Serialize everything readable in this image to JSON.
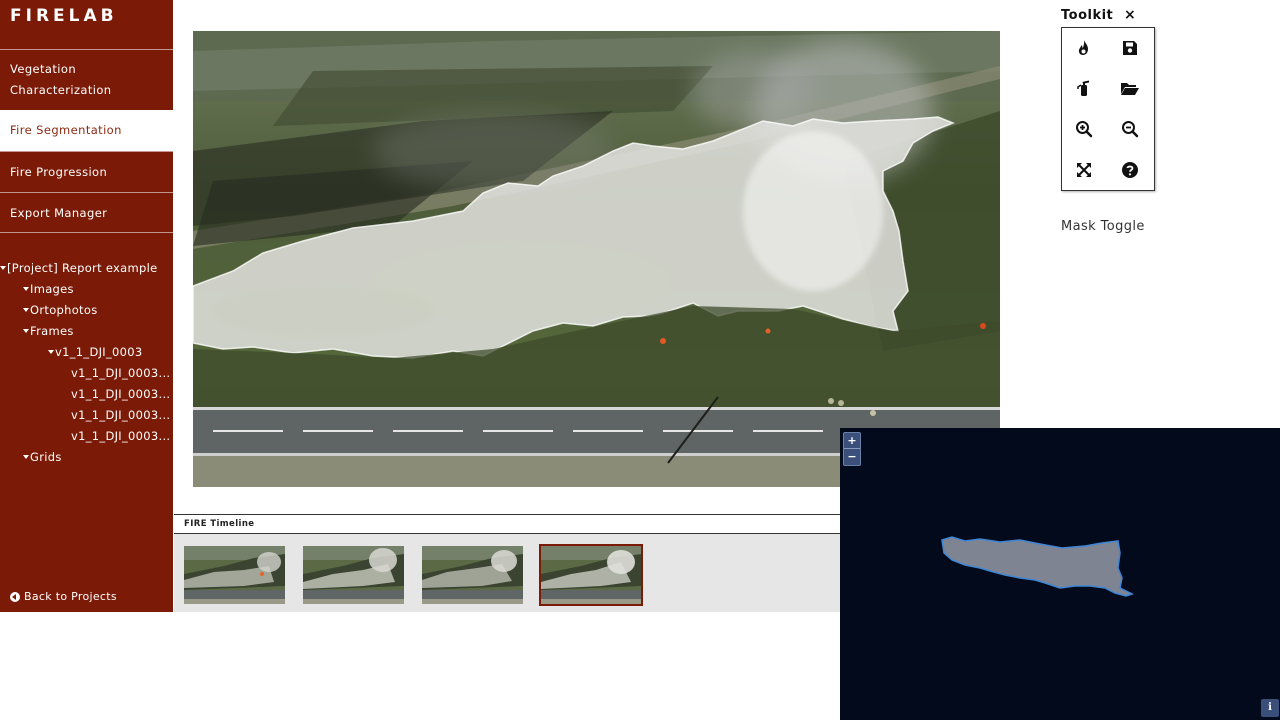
{
  "app": {
    "logo": "FIRELAB"
  },
  "sidebar": {
    "nav": [
      {
        "label": "Vegetation Characterization",
        "active": false
      },
      {
        "label": "Fire Segmentation",
        "active": true
      },
      {
        "label": "Fire Progression",
        "active": false
      },
      {
        "label": "Export Manager",
        "active": false
      }
    ],
    "tree": {
      "project": "[Project] Report example",
      "images": "Images",
      "ortophotos": "Ortophotos",
      "frames": "Frames",
      "frame_group": "v1_1_DJI_0003",
      "frame_items": [
        "v1_1_DJI_0003...",
        "v1_1_DJI_0003...",
        "v1_1_DJI_0003...",
        "v1_1_DJI_0003..."
      ],
      "grids": "Grids"
    },
    "back_label": "Back to Projects"
  },
  "timeline": {
    "title": "FIRE Timeline",
    "frame_count": 4,
    "selected_index": 3
  },
  "toolkit": {
    "title": "Toolkit",
    "close": "×",
    "tools": [
      "fire-icon",
      "save-icon",
      "extinguisher-icon",
      "folder-open-icon",
      "zoom-in-icon",
      "zoom-out-icon",
      "expand-icon",
      "help-icon"
    ]
  },
  "mask_toggle": "Mask Toggle",
  "map": {
    "zoom_in": "+",
    "zoom_out": "−",
    "info": "i"
  },
  "colors": {
    "sidebar": "#7a1a07",
    "map_bg": "#030a1c",
    "mask_fill": "#7f8492",
    "mask_stroke": "#3f86d6"
  }
}
